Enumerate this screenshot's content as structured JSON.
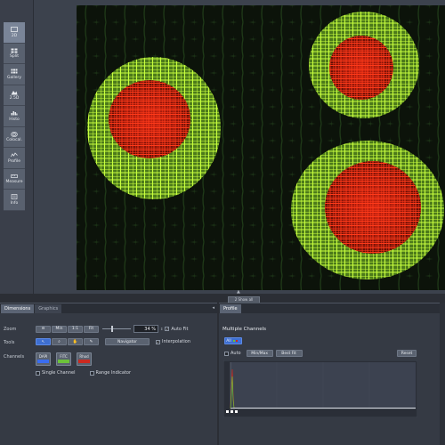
{
  "colors": {
    "accent": "#3e6fd1",
    "channel_green": "#6cc23a",
    "channel_red": "#cc2a20",
    "channel_dapi": "#3a6df0",
    "background": "#2b2e35"
  },
  "view_toolbar": {
    "items": [
      {
        "label": "2D",
        "icon": "2d-view-icon"
      },
      {
        "label": "Split",
        "icon": "split-view-icon"
      },
      {
        "label": "Gallery",
        "icon": "gallery-icon"
      },
      {
        "label": "2.5D",
        "icon": "2-5d-view-icon"
      },
      {
        "label": "Histo",
        "icon": "histogram-icon"
      },
      {
        "label": "Colocal.",
        "icon": "colocalization-icon"
      },
      {
        "label": "Profile",
        "icon": "profile-icon"
      },
      {
        "label": "Measure",
        "icon": "measure-icon"
      },
      {
        "label": "Info",
        "icon": "info-icon"
      }
    ],
    "active_index": 0
  },
  "image_tab_label": "2 Show all",
  "left_panel": {
    "tabs": [
      "Dimensions",
      "Graphics"
    ],
    "zoom_label": "Zoom",
    "zoom_buttons": [
      "",
      "Min",
      "1:1",
      "Fit"
    ],
    "zoom_value": "34 %",
    "auto_fit_label": "Auto Fit",
    "tools_label": "Tools",
    "navigator_label": "Navigator",
    "interpolation_label": "Interpolation",
    "channels_label": "Channels",
    "channels": [
      {
        "label": "DAPI",
        "color": "#3a6df0"
      },
      {
        "label": "FITC",
        "color": "#6cc23a"
      },
      {
        "label": "Rhod",
        "color": "#cc2a20"
      }
    ],
    "single_channel_label": "Single Channel",
    "range_indicator_label": "Range Indicator"
  },
  "right_panel": {
    "tabs": [
      "Profile"
    ],
    "title": "Multiple Channels",
    "all_label": "All",
    "auto_label": "Auto",
    "min_max_label": "Min/Max",
    "best_fit_label": "Best Fit",
    "reset_label": "Reset"
  }
}
